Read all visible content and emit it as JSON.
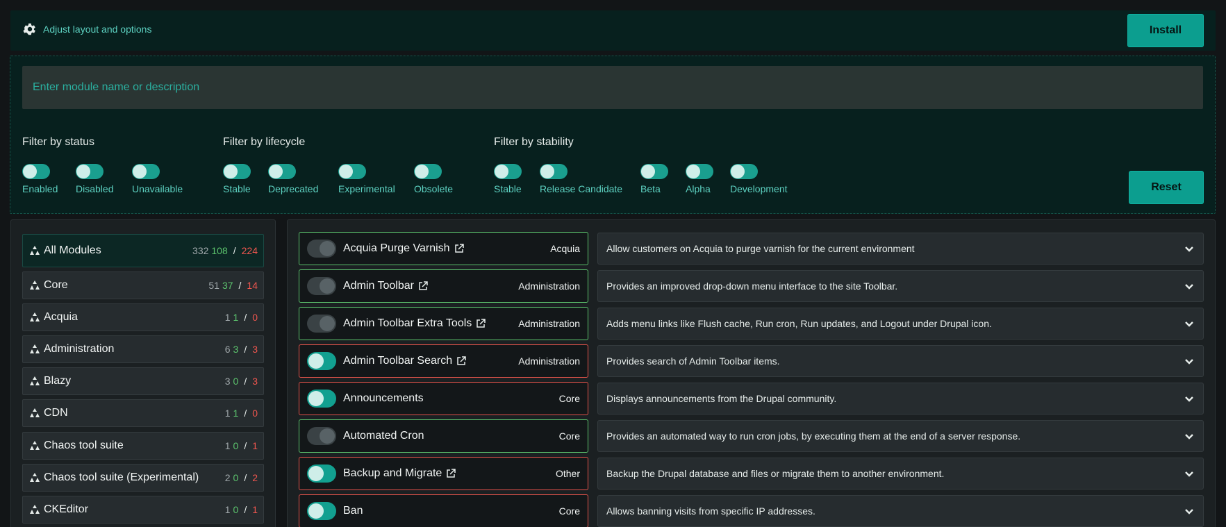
{
  "header": {
    "adjust_label": "Adjust layout and options",
    "install_label": "Install"
  },
  "search": {
    "placeholder": "Enter module name or description"
  },
  "filters": {
    "status": {
      "title": "Filter by status",
      "options": [
        "Enabled",
        "Disabled",
        "Unavailable"
      ]
    },
    "lifecycle": {
      "title": "Filter by lifecycle",
      "options": [
        "Stable",
        "Deprecated",
        "Experimental",
        "Obsolete"
      ]
    },
    "stability": {
      "title": "Filter by stability",
      "options": [
        "Stable",
        "Release Candidate",
        "Beta",
        "Alpha",
        "Development"
      ]
    },
    "reset_label": "Reset"
  },
  "categories": [
    {
      "label": "All Modules",
      "total": "332",
      "green": "108",
      "red": "224"
    },
    {
      "label": "Core",
      "total": "51",
      "green": "37",
      "red": "14"
    },
    {
      "label": "Acquia",
      "total": "1",
      "green": "1",
      "red": "0"
    },
    {
      "label": "Administration",
      "total": "6",
      "green": "3",
      "red": "3"
    },
    {
      "label": "Blazy",
      "total": "3",
      "green": "0",
      "red": "3"
    },
    {
      "label": "CDN",
      "total": "1",
      "green": "1",
      "red": "0"
    },
    {
      "label": "Chaos tool suite",
      "total": "1",
      "green": "0",
      "red": "1"
    },
    {
      "label": "Chaos tool suite (Experimental)",
      "total": "2",
      "green": "0",
      "red": "2"
    },
    {
      "label": "CKEditor",
      "total": "1",
      "green": "0",
      "red": "1"
    }
  ],
  "count_separator": "/",
  "modules": [
    {
      "name": "Acquia Purge Varnish",
      "category": "Acquia",
      "description": "Allow customers on Acquia to purge varnish for the current environment",
      "enabled": false,
      "external": true,
      "border": "green"
    },
    {
      "name": "Admin Toolbar",
      "category": "Administration",
      "description": "Provides an improved drop-down menu interface to the site Toolbar.",
      "enabled": false,
      "external": true,
      "border": "green"
    },
    {
      "name": "Admin Toolbar Extra Tools",
      "category": "Administration",
      "description": "Adds menu links like Flush cache, Run cron, Run updates, and Logout under Drupal icon.",
      "enabled": false,
      "external": true,
      "border": "green"
    },
    {
      "name": "Admin Toolbar Search",
      "category": "Administration",
      "description": "Provides search of Admin Toolbar items.",
      "enabled": true,
      "external": true,
      "border": "red"
    },
    {
      "name": "Announcements",
      "category": "Core",
      "description": "Displays announcements from the Drupal community.",
      "enabled": true,
      "external": false,
      "border": "red"
    },
    {
      "name": "Automated Cron",
      "category": "Core",
      "description": "Provides an automated way to run cron jobs, by executing them at the end of a server response.",
      "enabled": false,
      "external": false,
      "border": "green"
    },
    {
      "name": "Backup and Migrate",
      "category": "Other",
      "description": "Backup the Drupal database and files or migrate them to another environment.",
      "enabled": true,
      "external": true,
      "border": "red"
    },
    {
      "name": "Ban",
      "category": "Core",
      "description": "Allows banning visits from specific IP addresses.",
      "enabled": true,
      "external": false,
      "border": "red"
    }
  ],
  "colors": {
    "accent": "#0c9e8f",
    "green": "#5cc36d",
    "red": "#e5534b"
  }
}
